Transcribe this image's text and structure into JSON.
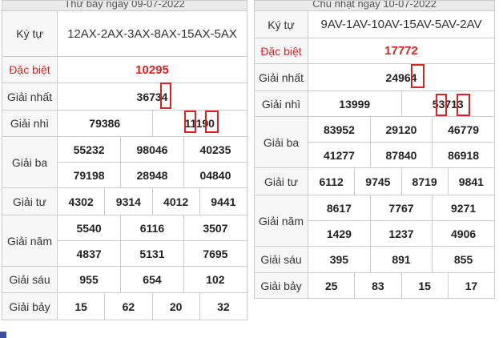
{
  "left": {
    "caption": "Thứ bảy ngày 09-07-2022",
    "ky_tu_label": "Ký tự",
    "ky_tu": "12AX-2AX-3AX-8AX-15AX-5AX",
    "dac_biet_label": "Đặc biệt",
    "dac_biet": "10295",
    "giai_nhat_label": "Giải nhất",
    "giai_nhat": "36734",
    "giai_nhi_label": "Giải nhì",
    "giai_nhi": [
      "79386",
      "11190"
    ],
    "giai_ba_label": "Giải ba",
    "giai_ba": [
      "55232",
      "98046",
      "40235",
      "79198",
      "28948",
      "04840"
    ],
    "giai_tu_label": "Giải tư",
    "giai_tu": [
      "4302",
      "9314",
      "4012",
      "9441"
    ],
    "giai_nam_label": "Giải năm",
    "giai_nam": [
      "5540",
      "6116",
      "3507",
      "4837",
      "5131",
      "7695"
    ],
    "giai_sau_label": "Giải sáu",
    "giai_sau": [
      "955",
      "654",
      "102"
    ],
    "giai_bay_label": "Giải bảy",
    "giai_bay": [
      "15",
      "62",
      "20",
      "32"
    ]
  },
  "right": {
    "caption": "Chủ nhật ngày 10-07-2022",
    "ky_tu_label": "Ký tự",
    "ky_tu": "9AV-1AV-10AV-15AV-5AV-2AV",
    "dac_biet_label": "Đặc biệt",
    "dac_biet": "17772",
    "giai_nhat_label": "Giải nhất",
    "giai_nhat": "24964",
    "giai_nhi_label": "Giải nhì",
    "giai_nhi": [
      "13999",
      "53713"
    ],
    "giai_ba_label": "Giải ba",
    "giai_ba": [
      "83952",
      "29120",
      "46779",
      "41277",
      "87840",
      "86918"
    ],
    "giai_tu_label": "Giải tư",
    "giai_tu": [
      "6112",
      "9745",
      "8719",
      "9841"
    ],
    "giai_nam_label": "Giải năm",
    "giai_nam": [
      "8617",
      "7767",
      "9271",
      "1429",
      "1237",
      "4906"
    ],
    "giai_sau_label": "Giải sáu",
    "giai_sau": [
      "395",
      "891",
      "855"
    ],
    "giai_bay_label": "Giải bảy",
    "giai_bay": [
      "25",
      "83",
      "15",
      "17"
    ]
  },
  "colors": {
    "accent_red": "#e02020",
    "border": "#cccccc",
    "label_bg": "#f7f7f7"
  }
}
